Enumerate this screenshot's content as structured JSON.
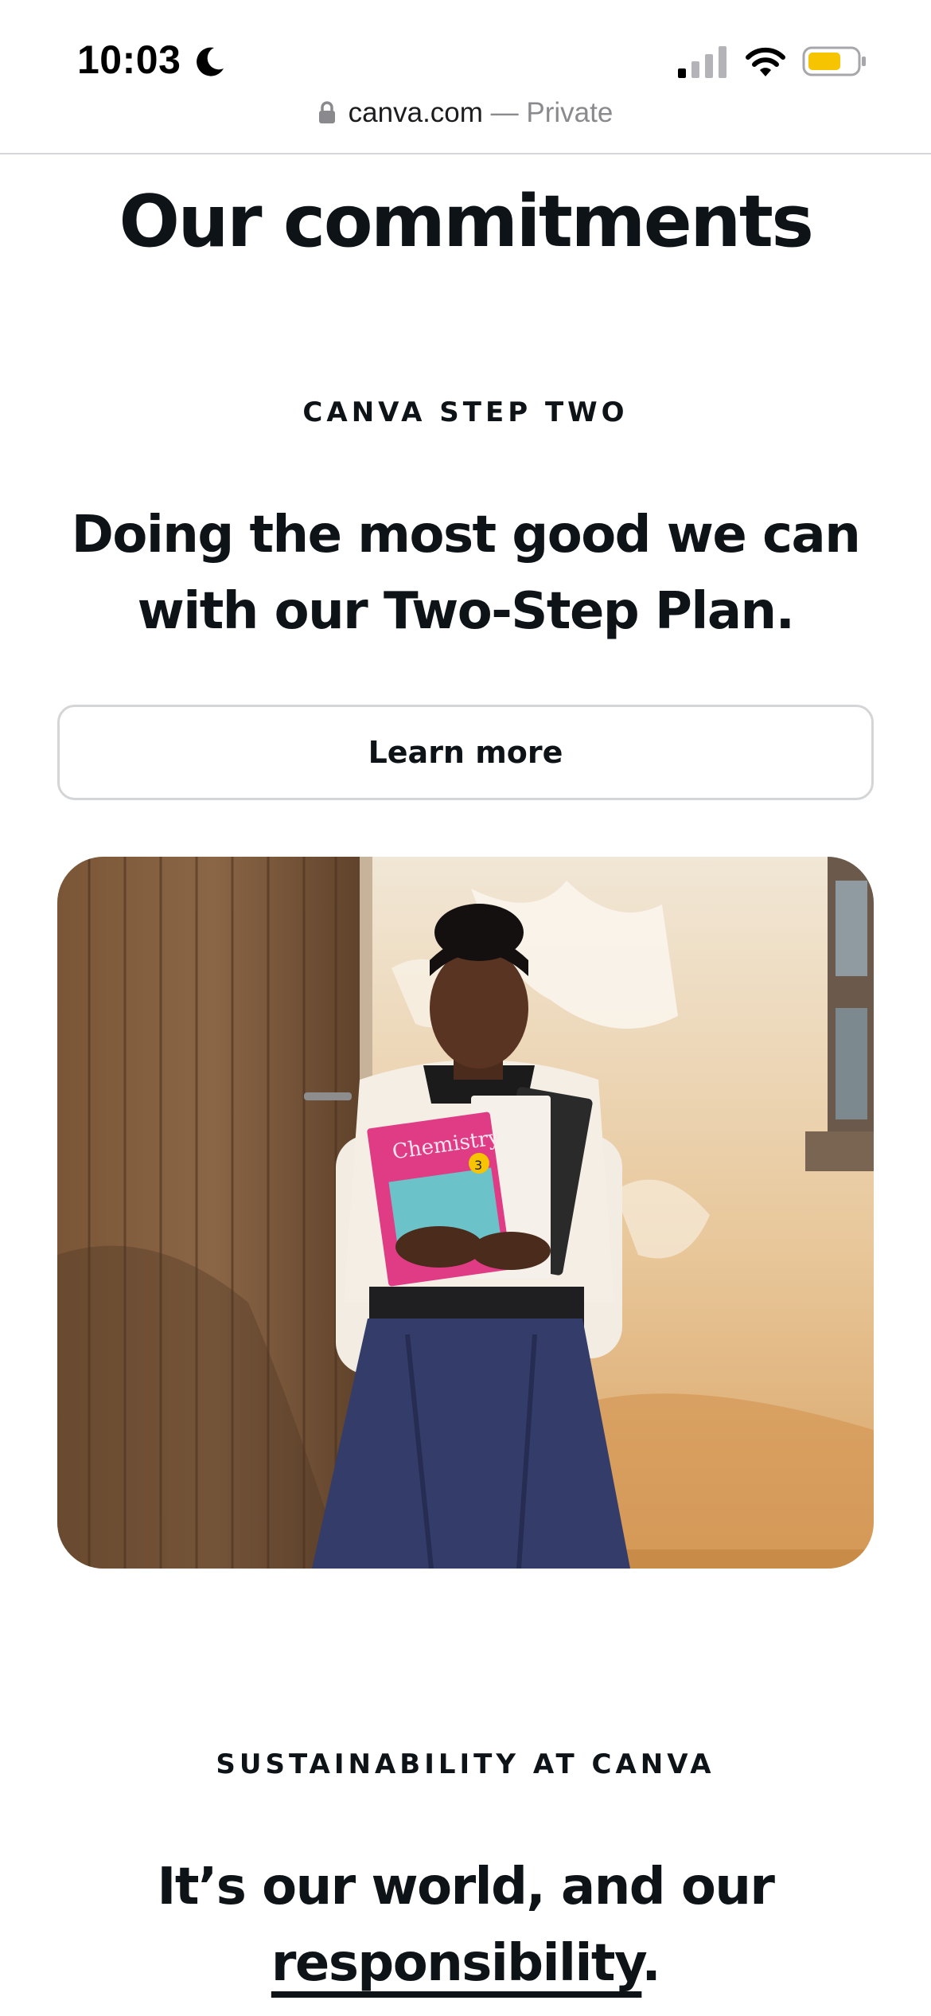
{
  "status_bar": {
    "time": "10:03",
    "icons": [
      "moon-icon",
      "signal-icon",
      "wifi-icon",
      "battery-icon"
    ],
    "battery_color": "#f6c400"
  },
  "url_bar": {
    "domain": "canva.com",
    "separator": " — ",
    "mode": "Private",
    "icon": "lock-icon"
  },
  "main": {
    "title": "Our commitments",
    "step_section": {
      "eyebrow": "CANVA STEP TWO",
      "headline_line1": "Doing the most good we can",
      "headline_line2": "with our Two-Step Plan.",
      "button_label": "Learn more"
    },
    "photo": {
      "book_title": "Chemistry",
      "book_number": "3"
    },
    "sustainability_section": {
      "eyebrow": "SUSTAINABILITY AT CANVA",
      "headline_line1": "It’s our world, and our",
      "headline_underlined": "responsibility",
      "headline_end": "."
    }
  },
  "colors": {
    "text": "#0e1318",
    "button_border": "#d4d5d7",
    "url_muted": "#8a8a8e"
  }
}
